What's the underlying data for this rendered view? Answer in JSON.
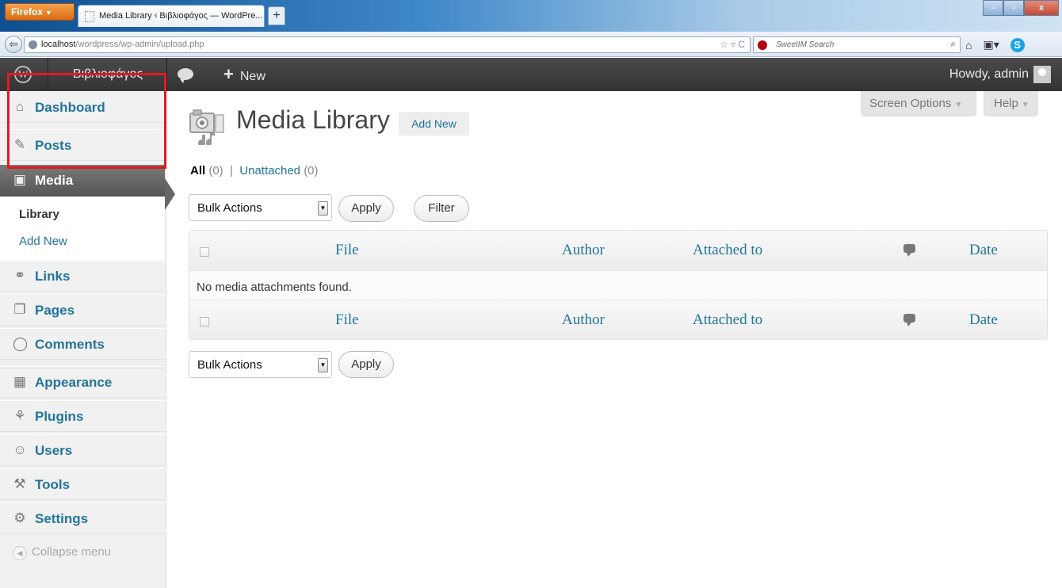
{
  "browser": {
    "menu_button": "Firefox",
    "tab_title": "Media Library ‹ Βιβλιοφάγος — WordPre...",
    "new_tab": "+",
    "url_host": "localhost",
    "url_path": "/wordpress/wp-admin/upload.php",
    "search_placeholder": "SweetIM Search",
    "window_controls": {
      "minimize": "‒",
      "maximize": "▫",
      "close": "x"
    }
  },
  "adminbar": {
    "site_name": "Βιβλιοφάγος",
    "new_label": "New",
    "greeting": "Howdy, admin"
  },
  "sidebar": {
    "items": [
      {
        "label": "Dashboard",
        "icon": "home-icon"
      },
      {
        "label": "Posts",
        "icon": "pin-icon"
      },
      {
        "label": "Media",
        "icon": "media-icon"
      },
      {
        "label": "Links",
        "icon": "link-icon"
      },
      {
        "label": "Pages",
        "icon": "pages-icon"
      },
      {
        "label": "Comments",
        "icon": "comment-icon"
      },
      {
        "label": "Appearance",
        "icon": "appearance-icon"
      },
      {
        "label": "Plugins",
        "icon": "plugin-icon"
      },
      {
        "label": "Users",
        "icon": "users-icon"
      },
      {
        "label": "Tools",
        "icon": "tools-icon"
      },
      {
        "label": "Settings",
        "icon": "settings-icon"
      }
    ],
    "media_submenu": {
      "library": "Library",
      "add_new": "Add New"
    },
    "collapse": "Collapse menu"
  },
  "main": {
    "screen_options": "Screen Options",
    "help": "Help",
    "page_title": "Media Library",
    "add_new": "Add New",
    "filters": {
      "all": "All",
      "all_count": "(0)",
      "separator": "|",
      "unattached": "Unattached",
      "unattached_count": "(0)"
    },
    "bulk_actions": "Bulk Actions",
    "apply": "Apply",
    "filter": "Filter",
    "columns": {
      "file": "File",
      "author": "Author",
      "attached_to": "Attached to",
      "date": "Date"
    },
    "empty_message": "No media attachments found."
  },
  "colors": {
    "link": "#21759b",
    "highlight_border": "#e01a22",
    "adminbar": "#464646"
  }
}
